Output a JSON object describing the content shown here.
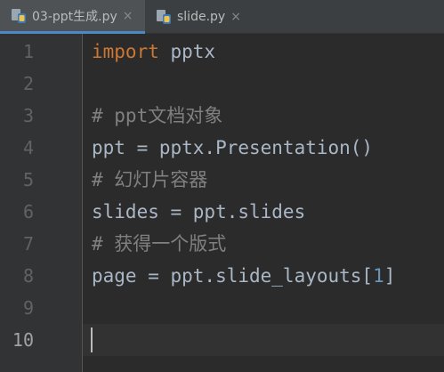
{
  "tabs": [
    {
      "label": "03-ppt生成.py",
      "icon": "python-file-icon",
      "active": true
    },
    {
      "label": "slide.py",
      "icon": "python-file-icon",
      "active": false
    }
  ],
  "close_glyph": "×",
  "gutter": {
    "line_numbers": [
      "1",
      "2",
      "3",
      "4",
      "5",
      "6",
      "7",
      "8",
      "9",
      "10"
    ],
    "current_line": "10"
  },
  "code": {
    "line1": {
      "keyword": "import",
      "rest": " pptx"
    },
    "line3": {
      "comment": "# ppt文档对象"
    },
    "line4": {
      "text": "ppt = pptx.Presentation()"
    },
    "line5": {
      "comment": "# 幻灯片容器"
    },
    "line6": {
      "text": "slides = ppt.slides"
    },
    "line7": {
      "comment": "# 获得一个版式"
    },
    "line8": {
      "before": "page = ppt.slide_layouts[",
      "number": "1",
      "after": "]"
    }
  },
  "colors": {
    "editor_bg": "#2b2b2b",
    "keyword": "#cc7832",
    "comment": "#808080",
    "number": "#6897bb",
    "text": "#a9b7c6",
    "tab_active_underline": "#4a88c7"
  }
}
